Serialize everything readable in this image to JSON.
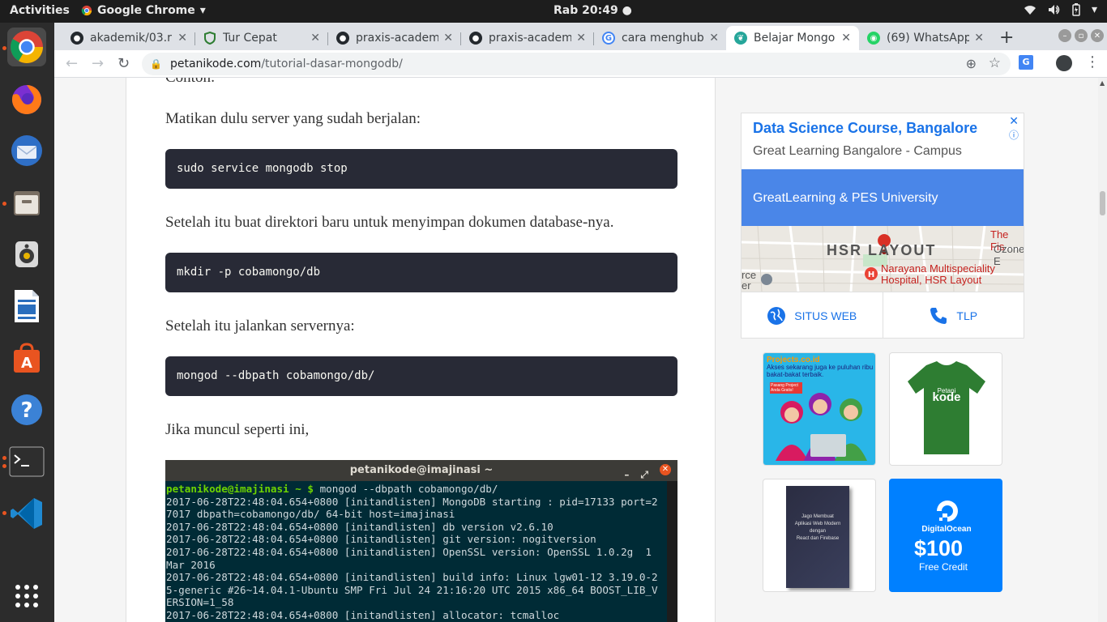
{
  "topbar": {
    "activities": "Activities",
    "app_name": "Google Chrome",
    "clock": "Rab 20:49"
  },
  "tabs": [
    {
      "title": "akademik/03.r",
      "icon": "github-icon"
    },
    {
      "title": "Tur Cepat",
      "icon": "shield-icon"
    },
    {
      "title": "praxis-academ",
      "icon": "github-icon"
    },
    {
      "title": "praxis-academ",
      "icon": "github-icon"
    },
    {
      "title": "cara menghub",
      "icon": "google-icon"
    },
    {
      "title": "Belajar Mongo",
      "icon": "petanikode-icon"
    },
    {
      "title": "(69) WhatsApp",
      "icon": "whatsapp-icon"
    }
  ],
  "address": {
    "host": "petanikode.com",
    "path": "/tutorial-dasar-mongodb/"
  },
  "article": {
    "partial_top": "Contoh:",
    "p1": "Matikan dulu server yang sudah berjalan:",
    "code1": "sudo service mongodb stop",
    "p2": "Setelah itu buat direktori baru untuk menyimpan dokumen database-nya.",
    "code2": "mkdir -p cobamongo/db",
    "p3": "Setelah itu jalankan servernya:",
    "code3": "mongod --dbpath cobamongo/db/",
    "p4": "Jika muncul seperti ini,"
  },
  "terminal": {
    "title": "petanikode@imajinasi ~",
    "prompt": "petanikode@imajinasi ~ $",
    "command": " mongod --dbpath cobamongo/db/",
    "lines": [
      "2017-06-28T22:48:04.654+0800 [initandlisten] MongoDB starting : pid=17133 port=2",
      "7017 dbpath=cobamongo/db/ 64-bit host=imajinasi",
      "2017-06-28T22:48:04.654+0800 [initandlisten] db version v2.6.10",
      "2017-06-28T22:48:04.654+0800 [initandlisten] git version: nogitversion",
      "2017-06-28T22:48:04.654+0800 [initandlisten] OpenSSL version: OpenSSL 1.0.2g  1",
      "Mar 2016",
      "2017-06-28T22:48:04.654+0800 [initandlisten] build info: Linux lgw01-12 3.19.0-2",
      "5-generic #26~14.04.1-Ubuntu SMP Fri Jul 24 21:16:20 UTC 2015 x86_64 BOOST_LIB_V",
      "ERSION=1_58",
      "2017-06-28T22:48:04.654+0800 [initandlisten] allocator: tcmalloc"
    ]
  },
  "ad": {
    "headline": "Data Science Course, Bangalore",
    "subline": "Great Learning Bangalore - Campus",
    "banner": "GreatLearning & PES University",
    "map_label": "HSR LAYOUT",
    "map_place1": "Narayana Multispeciality",
    "map_place2": "Hospital, HSR Layout",
    "map_corner1": "The Fis",
    "map_corner2": "Ozone E",
    "map_left": "rce",
    "map_left2": "er",
    "action_web": "SITUS WEB",
    "action_tel": "TLP"
  },
  "promos": {
    "projects_brand": "Projects.co.id",
    "projects_text": "Akses sekarang juga ke puluhan ribu bakat-bakat terbaik.",
    "projects_badge": "Pasang Project Anda Gratis!",
    "tshirt_line1": "Petani",
    "tshirt_line2": "kode",
    "book_line1": "Jago Membuat",
    "book_line2": "Aplikasi Web Modern",
    "book_line3": "dengan",
    "book_line4": "React dan Firebase",
    "do_brand": "DigitalOcean",
    "do_amount": "$100",
    "do_credit": "Free Credit"
  },
  "colors": {
    "accent_orange": "#e95420",
    "code_bg": "#282a36",
    "link_blue": "#1a73e8",
    "do_blue": "#0080ff"
  }
}
